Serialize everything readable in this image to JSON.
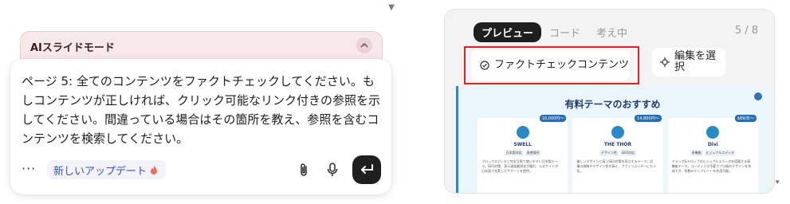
{
  "mode_banner": {
    "title": "AIスライドモード"
  },
  "chat": {
    "message": "ページ 5: 全てのコンテンツをファクトチェックしてください。もしコンテンツが正しければ、クリック可能なリンク付きの参照を示してください。間違っている場合はその箇所を教え、参照を含むコンテンツを検索してください。",
    "update_chip_label": "新しいアップデート",
    "more_label": "···"
  },
  "preview": {
    "tabs": [
      {
        "label": "プレビュー",
        "active": true
      },
      {
        "label": "コード",
        "active": false
      },
      {
        "label": "考え中",
        "active": false
      }
    ],
    "page_count": "5 / 8",
    "fact_check_label": "ファクトチェックコンテンツ",
    "edit_label": "編集を選択",
    "slide": {
      "title": "有料テーマのおすすめ",
      "cards": [
        {
          "name": "SWELL",
          "price": "16,000円〜",
          "tags": [
            "日本語対応",
            "直感操作"
          ],
          "desc": "ブロックエディタと完全互換で使いやすい日本製テーマ。SEO対策、表示速度最適化が優れ、公式サイトが日本語で充実したサポートを提供。"
        },
        {
          "name": "THE THOR",
          "price": "14,800円〜",
          "tags": [
            "デザイン性",
            "SEO対応"
          ],
          "desc": "美しいデザインと高いSEO対策を両立するテーマ。記事の装飾やデザイン性が高く、アフィリエイターにも人気。"
        },
        {
          "name": "Divi",
          "price": "$89/年〜",
          "tags": [
            "多機能",
            "ビジュアルエディタ"
          ],
          "desc": "ドラッグ&ドロップのビジュアルエディタを搭載する高機能テーマ。コーディング不要でプロ級のデザインを作成でき、多数のテンプレートを利用可能。"
        }
      ]
    }
  },
  "colors": {
    "send_button": "#1f1f1f",
    "banner_bg": "#f7e8ea",
    "highlight_border": "#e0232b",
    "chip_text": "#3452c9"
  }
}
